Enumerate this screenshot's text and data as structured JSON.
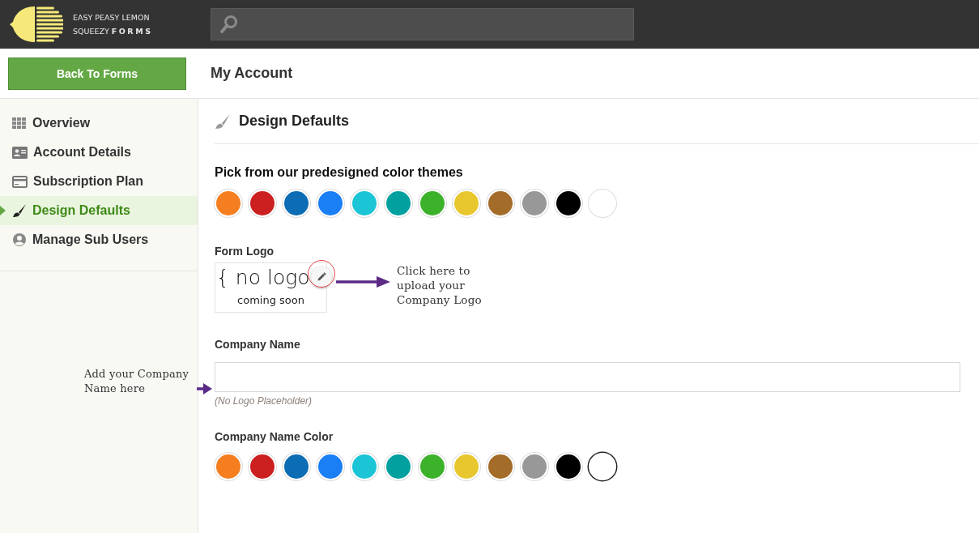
{
  "header": {
    "logo_text": [
      "EASY PEASY LEMON",
      "SQUEEZY"
    ],
    "logo_bold": "FORMS"
  },
  "toolbar": {
    "back_button": "Back To Forms",
    "page_title": "My Account"
  },
  "sidebar": {
    "items": [
      {
        "label": "Overview",
        "selected": false
      },
      {
        "label": "Account Details",
        "selected": false
      },
      {
        "label": "Subscription Plan",
        "selected": false
      },
      {
        "label": "Design Defaults",
        "selected": true
      },
      {
        "label": "Manage Sub Users",
        "selected": false
      }
    ]
  },
  "panel": {
    "title": "Design Defaults",
    "themes": {
      "label": "Pick from our predesigned color themes",
      "swatches": [
        {
          "color": "#f57f20",
          "selected": false
        },
        {
          "color": "#cc2020",
          "selected": false
        },
        {
          "color": "#0c6cb4",
          "selected": false
        },
        {
          "color": "#1a7ef5",
          "selected": false
        },
        {
          "color": "#1bc5d6",
          "selected": false
        },
        {
          "color": "#02a09f",
          "selected": false
        },
        {
          "color": "#3cb22a",
          "selected": false
        },
        {
          "color": "#e8c62e",
          "selected": false
        },
        {
          "color": "#a36c28",
          "selected": false
        },
        {
          "color": "#989898",
          "selected": false
        },
        {
          "color": "#000000",
          "selected": false
        },
        {
          "color": "#ffffff",
          "selected": false
        }
      ]
    },
    "logo": {
      "label": "Form Logo",
      "logo_main": "{ no logo",
      "logo_sub": "coming soon"
    },
    "company_name": {
      "label": "Company Name",
      "hint": "(No Logo Placeholder)"
    },
    "name_color": {
      "label": "Company Name Color",
      "swatches": [
        {
          "color": "#f57f20",
          "selected": false
        },
        {
          "color": "#cc2020",
          "selected": false
        },
        {
          "color": "#0c6cb4",
          "selected": false
        },
        {
          "color": "#1a7ef5",
          "selected": false
        },
        {
          "color": "#1bc5d6",
          "selected": false
        },
        {
          "color": "#02a09f",
          "selected": false
        },
        {
          "color": "#3cb22a",
          "selected": false
        },
        {
          "color": "#e8c62e",
          "selected": false
        },
        {
          "color": "#a36c28",
          "selected": false
        },
        {
          "color": "#989898",
          "selected": false
        },
        {
          "color": "#000000",
          "selected": false
        },
        {
          "color": "#ffffff",
          "selected": true
        }
      ]
    }
  },
  "annotations": [
    "Click here to upload your Company Logo",
    "Add your Company Name here"
  ]
}
